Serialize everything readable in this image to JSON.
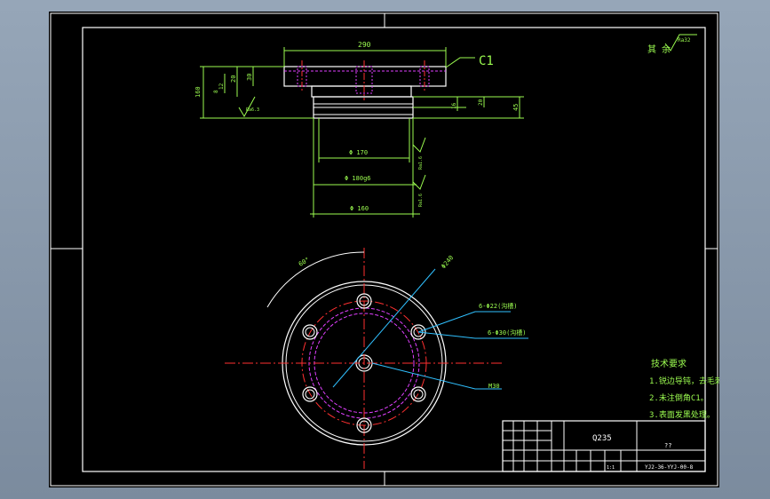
{
  "drawing": {
    "dims": {
      "overall_width": "290",
      "left_h1": "30",
      "left_h2": "160",
      "left_h3": "20",
      "left_h4": "12",
      "left_h5": "8",
      "right_h1": "16",
      "right_h2": "20",
      "right_h3": "45",
      "dia_170": "Φ 170",
      "dia_180": "Φ 180g6",
      "dia_160": "Φ 160",
      "rough_left": "Ra6.3",
      "rough_r1": "Ra1.6",
      "rough_r2": "Ra1.6",
      "chamfer": "C1",
      "angle": "60°",
      "pcd": "Φ240",
      "holes_1": "6-Φ22(沟槽)",
      "holes_2": "6-Φ30(沟槽)",
      "thread": "M30"
    },
    "note_corner": {
      "other": "其 余",
      "ra": "Ra32"
    },
    "tech_req": {
      "title": "技术要求",
      "line1": "1.锐边导钝，去毛刺。",
      "line2": "2.未注倒角C1。",
      "line3": "3.表面发黑处理。"
    },
    "title_block": {
      "material": "Q235",
      "name": "??",
      "code": "YJ2-36-YYJ-00-8",
      "scale": "1:1"
    }
  },
  "colors": {
    "sheet": "#000000",
    "outline": "#ffffff",
    "dimension": "#9cfd50",
    "center": "#ff3030",
    "hidden": "#e040ff",
    "leader": "#30c0ff",
    "title_block": "#50c8ff"
  }
}
